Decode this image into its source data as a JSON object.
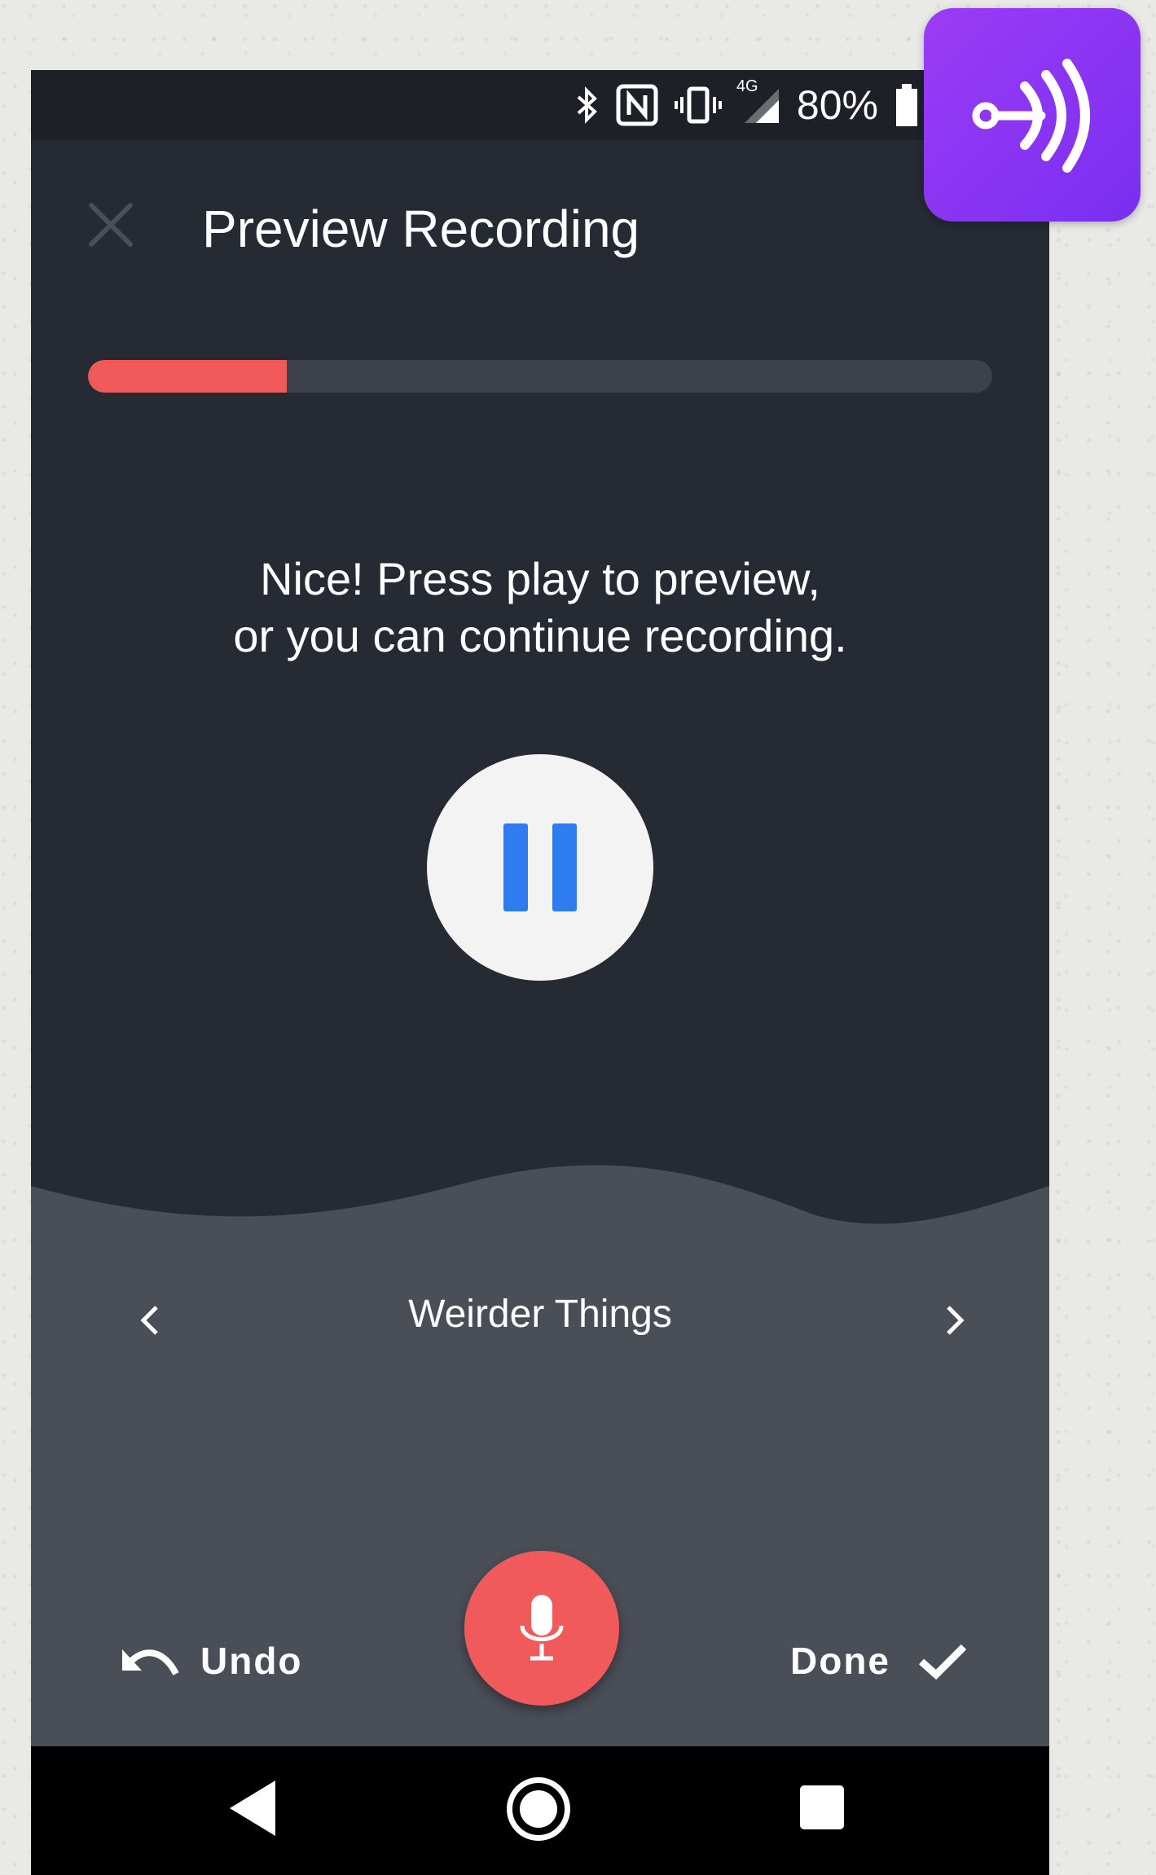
{
  "status_bar": {
    "bluetooth_icon": "bluetooth-icon",
    "nfc_icon": "nfc-icon",
    "vibrate_icon": "vibrate-icon",
    "network_label": "4G",
    "battery_text": "80%"
  },
  "header": {
    "title": "Preview Recording",
    "close_icon": "close-icon"
  },
  "progress": {
    "value_fraction": 0.22,
    "fill_color": "#f05a5b"
  },
  "message": {
    "line1": "Nice! Press play to preview,",
    "line2": "or you can continue recording."
  },
  "player": {
    "state_icon": "pause-icon",
    "accent_color": "#2e7cf0"
  },
  "track": {
    "title": "Weirder Things",
    "prev_icon": "chevron-left-icon",
    "next_icon": "chevron-right-icon"
  },
  "actions": {
    "undo_label": "Undo",
    "done_label": "Done",
    "mic_icon": "microphone-icon",
    "mic_color": "#f05a5b"
  },
  "system_nav": {
    "back": "back-icon",
    "home": "home-icon",
    "recents": "recents-icon"
  },
  "app_logo": {
    "icon": "anchor-app-logo",
    "color": "#8a35f3"
  }
}
